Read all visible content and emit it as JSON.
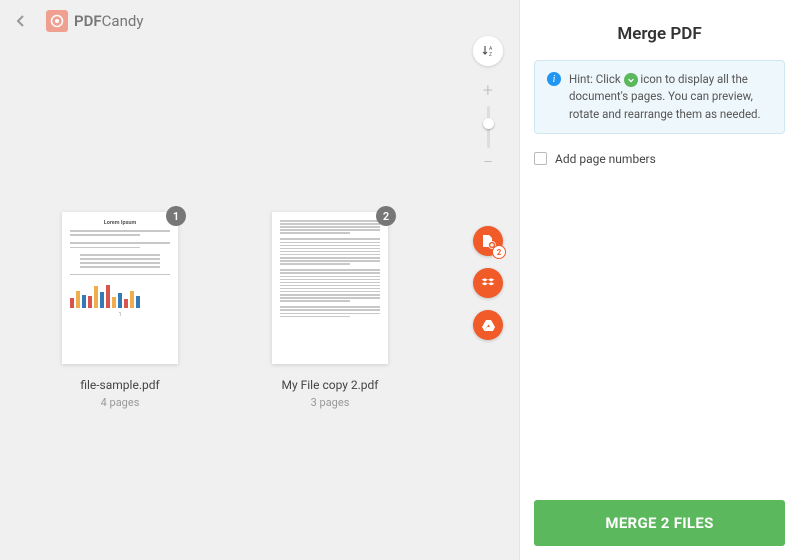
{
  "brand": {
    "name_bold": "PDF",
    "name_light": "Candy"
  },
  "panel": {
    "title": "Merge PDF"
  },
  "hint": {
    "prefix": "Hint: Click",
    "suffix": "icon to display all the document's pages. You can preview, rotate and rearrange them as needed."
  },
  "options": {
    "add_page_numbers": "Add page numbers"
  },
  "cta": "MERGE 2 FILES",
  "add": {
    "badge": "2"
  },
  "files": [
    {
      "index": "1",
      "name": "file-sample.pdf",
      "pages": "4 pages",
      "thumb_title": "Lorem Ipsum",
      "thumb_page": "1"
    },
    {
      "index": "2",
      "name": "My File copy 2.pdf",
      "pages": "3 pages"
    }
  ]
}
